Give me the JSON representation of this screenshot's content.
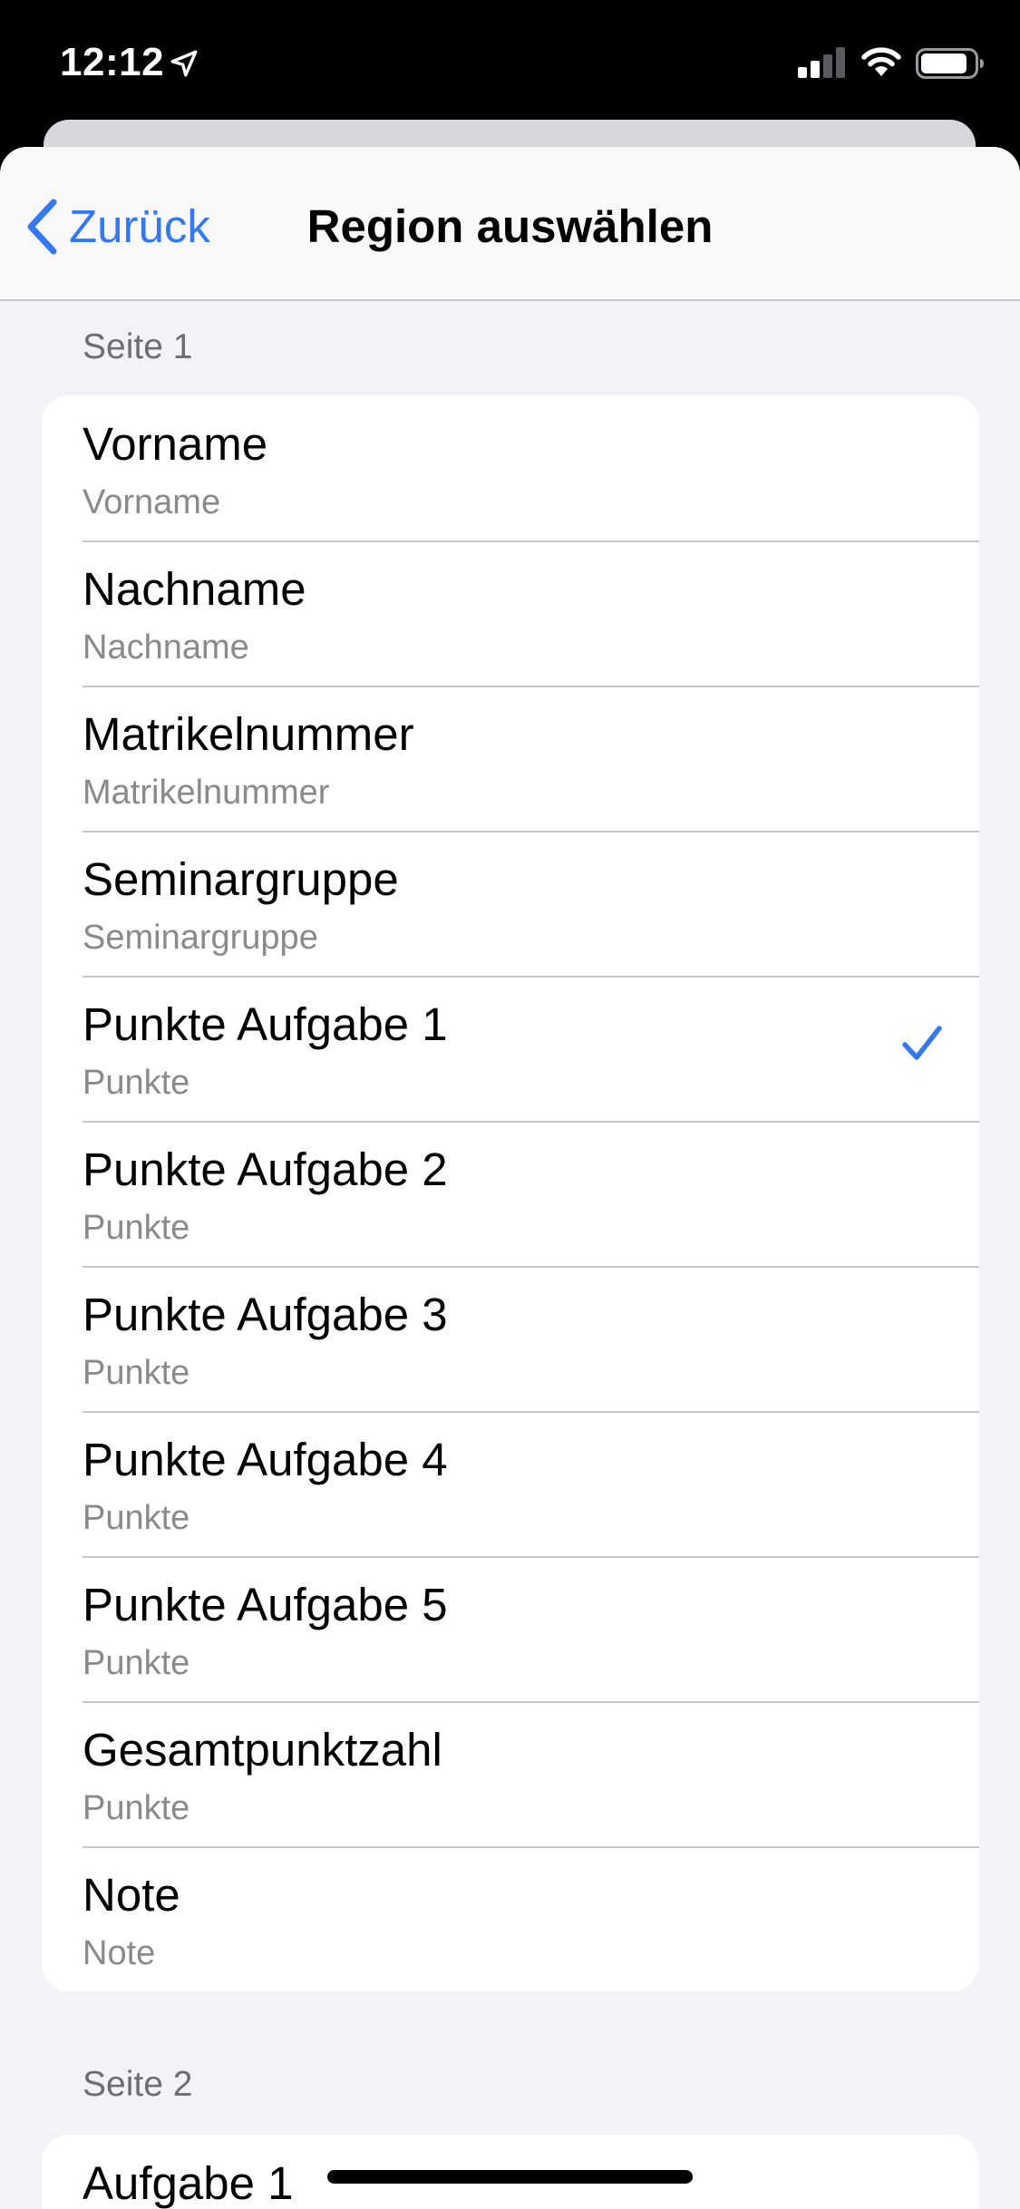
{
  "status_bar": {
    "time": "12:12",
    "icons": [
      "location-arrow-icon",
      "cellular-signal-icon",
      "wifi-icon",
      "battery-icon"
    ]
  },
  "nav": {
    "back_label": "Zurück",
    "title": "Region auswählen"
  },
  "sections": [
    {
      "header": "Seite 1",
      "items": [
        {
          "title": "Vorname",
          "subtitle": "Vorname",
          "selected": false
        },
        {
          "title": "Nachname",
          "subtitle": "Nachname",
          "selected": false
        },
        {
          "title": "Matrikelnummer",
          "subtitle": "Matrikelnummer",
          "selected": false
        },
        {
          "title": "Seminargruppe",
          "subtitle": "Seminargruppe",
          "selected": false
        },
        {
          "title": "Punkte Aufgabe 1",
          "subtitle": "Punkte",
          "selected": true
        },
        {
          "title": "Punkte Aufgabe 2",
          "subtitle": "Punkte",
          "selected": false
        },
        {
          "title": "Punkte Aufgabe 3",
          "subtitle": "Punkte",
          "selected": false
        },
        {
          "title": "Punkte Aufgabe 4",
          "subtitle": "Punkte",
          "selected": false
        },
        {
          "title": "Punkte Aufgabe 5",
          "subtitle": "Punkte",
          "selected": false
        },
        {
          "title": "Gesamtpunktzahl",
          "subtitle": "Punkte",
          "selected": false
        },
        {
          "title": "Note",
          "subtitle": "Note",
          "selected": false
        }
      ]
    },
    {
      "header": "Seite 2",
      "items": [
        {
          "title": "Aufgabe 1"
        }
      ]
    }
  ],
  "colors": {
    "accent": "#3478f6",
    "background": "#f2f2f7",
    "secondary_text": "#8a8a8e",
    "section_header": "#6d6d72"
  }
}
